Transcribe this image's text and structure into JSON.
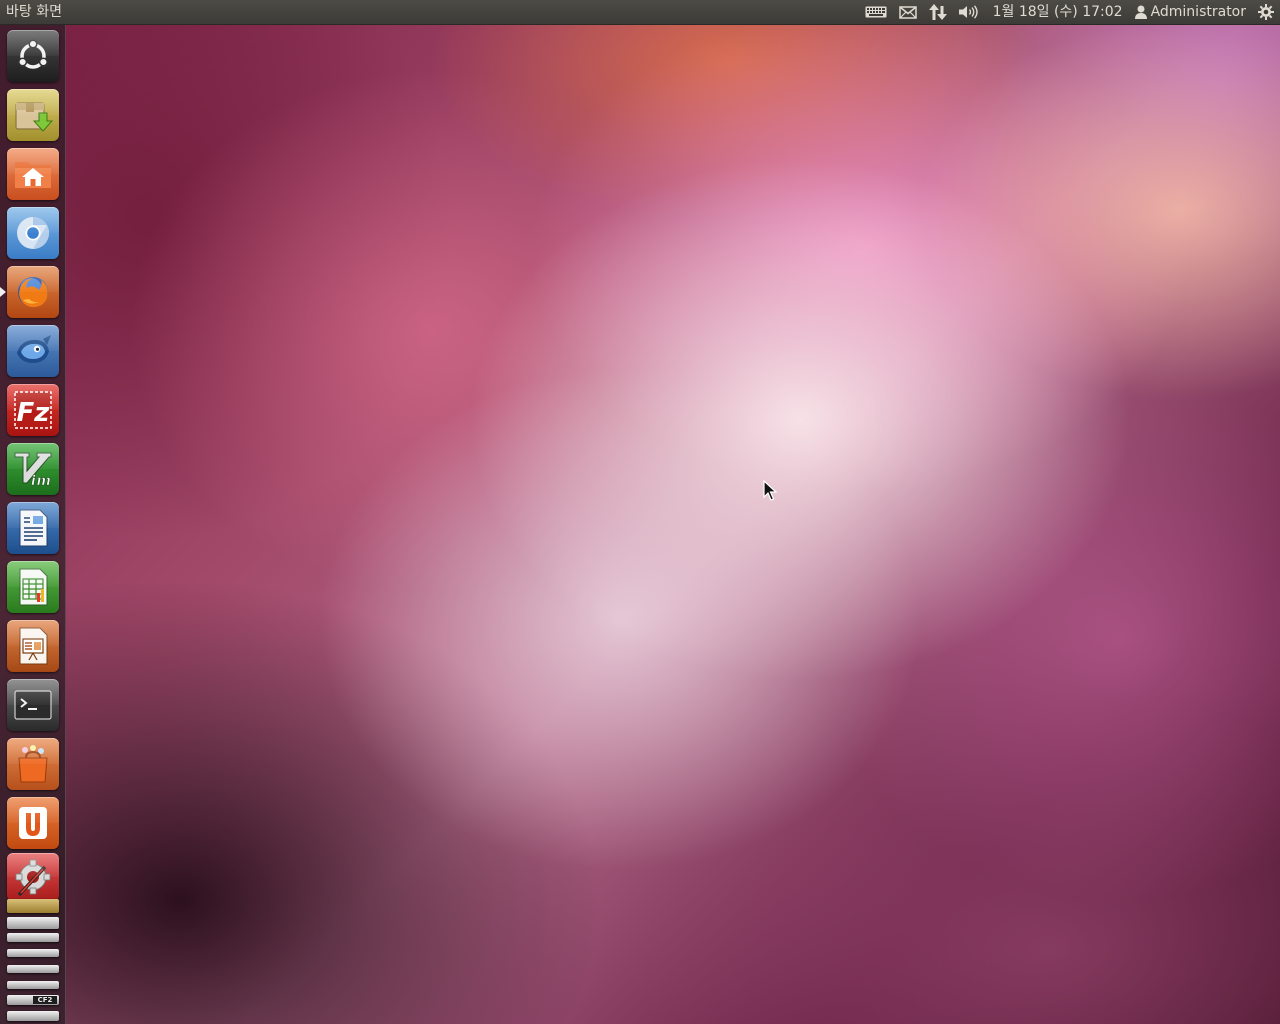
{
  "panel": {
    "title": "바탕 화면",
    "clock": "1월 18일 (수) 17:02",
    "user": "Administrator",
    "indicators": [
      "keyboard-icon",
      "mail-icon",
      "network-icon",
      "volume-icon",
      "user-icon",
      "session-gear-icon"
    ]
  },
  "launcher": {
    "items": [
      {
        "name": "dash-home",
        "icon": "ubuntu-logo-icon"
      },
      {
        "name": "update-manager",
        "icon": "package-download-icon"
      },
      {
        "name": "home-folder",
        "icon": "home-folder-icon"
      },
      {
        "name": "chromium",
        "icon": "chromium-icon"
      },
      {
        "name": "firefox",
        "icon": "firefox-icon",
        "running": true
      },
      {
        "name": "thunderbird",
        "icon": "thunderbird-bird-icon"
      },
      {
        "name": "filezilla",
        "icon": "filezilla-icon",
        "label": "Fz"
      },
      {
        "name": "gvim",
        "icon": "vim-icon",
        "label": "Vim"
      },
      {
        "name": "libreoffice-writer",
        "icon": "writer-document-icon"
      },
      {
        "name": "libreoffice-calc",
        "icon": "calc-spreadsheet-icon"
      },
      {
        "name": "libreoffice-impress",
        "icon": "impress-presentation-icon"
      },
      {
        "name": "terminal",
        "icon": "terminal-icon",
        "label": ">_"
      },
      {
        "name": "ubuntu-software-center",
        "icon": "software-center-bag-icon"
      },
      {
        "name": "ubuntu-one",
        "icon": "ubuntu-one-icon",
        "label": "U"
      },
      {
        "name": "system-settings",
        "icon": "settings-tools-icon"
      }
    ],
    "stack_label": "CF2"
  },
  "colors": {
    "panel_bg": "#3c3b37",
    "panel_text": "#dfdbd2",
    "launcher_bg": "#2c1c24",
    "wallpaper_accent": "#b5557c"
  }
}
